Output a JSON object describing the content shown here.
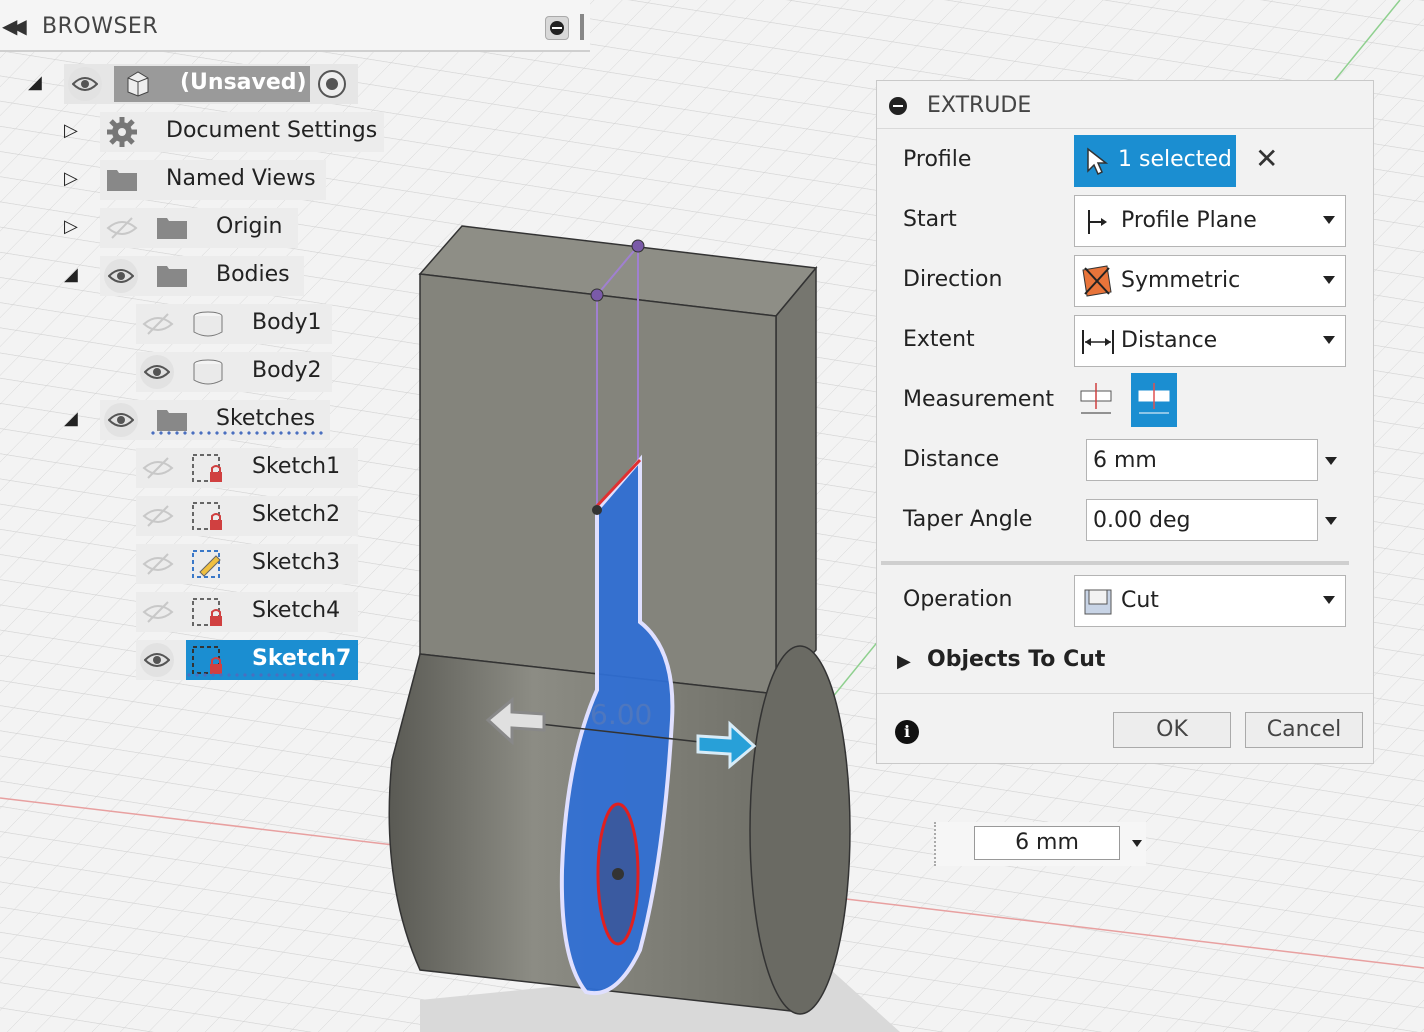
{
  "browser": {
    "title": "BROWSER",
    "root": {
      "label": "(Unsaved)"
    },
    "items": [
      {
        "label": "Document Settings"
      },
      {
        "label": "Named Views"
      },
      {
        "label": "Origin"
      },
      {
        "label": "Bodies"
      },
      {
        "label": "Body1"
      },
      {
        "label": "Body2"
      },
      {
        "label": "Sketches"
      },
      {
        "label": "Sketch1"
      },
      {
        "label": "Sketch2"
      },
      {
        "label": "Sketch3"
      },
      {
        "label": "Sketch4"
      },
      {
        "label": "Sketch7"
      }
    ]
  },
  "extrude": {
    "title": "EXTRUDE",
    "profile": {
      "label": "Profile",
      "value": "1 selected"
    },
    "start": {
      "label": "Start",
      "value": "Profile Plane"
    },
    "direction": {
      "label": "Direction",
      "value": "Symmetric"
    },
    "extent": {
      "label": "Extent",
      "value": "Distance"
    },
    "measurement": {
      "label": "Measurement"
    },
    "distance": {
      "label": "Distance",
      "value": "6 mm"
    },
    "taper": {
      "label": "Taper Angle",
      "value": "0.00 deg"
    },
    "operation": {
      "label": "Operation",
      "value": "Cut"
    },
    "objects_to_cut": {
      "label": "Objects To Cut"
    },
    "ok_label": "OK",
    "cancel_label": "Cancel"
  },
  "viewport": {
    "dimension_label": "6.00",
    "float_value": "6 mm"
  },
  "colors": {
    "accent": "#1b8ed1",
    "profile_fill": "#2f6fd6",
    "body": "#7a7a72"
  }
}
